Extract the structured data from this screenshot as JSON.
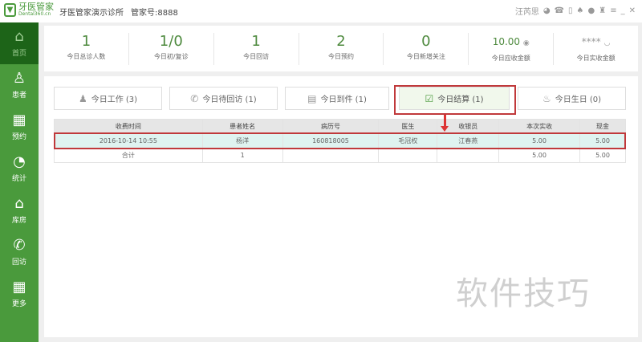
{
  "app": {
    "logo_text": "牙医管家",
    "logo_sub": "Dental360.cn",
    "clinic": "牙医管家演示诊所",
    "account": "管家号:8888",
    "user": "汪芮思"
  },
  "window_icons": [
    "wechat-icon",
    "phone-icon",
    "mobile-icon",
    "bell-icon",
    "help-icon",
    "shirt-icon",
    "menu-icon",
    "minimize-icon",
    "close-icon"
  ],
  "sidebar": {
    "items": [
      {
        "label": "首页",
        "icon": "home-icon"
      },
      {
        "label": "患者",
        "icon": "person-icon"
      },
      {
        "label": "预约",
        "icon": "calendar-icon"
      },
      {
        "label": "统计",
        "icon": "pie-chart-icon"
      },
      {
        "label": "库房",
        "icon": "warehouse-icon"
      },
      {
        "label": "回访",
        "icon": "phone-icon"
      },
      {
        "label": "更多",
        "icon": "grid-icon"
      }
    ]
  },
  "stats": [
    {
      "value": "1",
      "label": "今日总诊人数"
    },
    {
      "value": "1/0",
      "label": "今日初/复诊"
    },
    {
      "value": "1",
      "label": "今日回访"
    },
    {
      "value": "2",
      "label": "今日预约"
    },
    {
      "value": "0",
      "label": "今日新增关注"
    },
    {
      "value": "10.00",
      "label": "今日应收金额"
    },
    {
      "value": "****",
      "label": "今日实收金额"
    }
  ],
  "tabs": [
    {
      "label": "今日工作 (3)"
    },
    {
      "label": "今日待回访 (1)"
    },
    {
      "label": "今日到件 (1)"
    },
    {
      "label": "今日结算 (1)"
    },
    {
      "label": "今日生日 (0)"
    }
  ],
  "table": {
    "headers": [
      "收费时间",
      "患者姓名",
      "病历号",
      "医生",
      "收银员",
      "本次实收",
      "现金"
    ],
    "rows": [
      [
        "2016-10-14 10:55",
        "杨洋",
        "160818005",
        "毛冠权",
        "江春燕",
        "5.00",
        "5.00"
      ],
      [
        "合计",
        "1",
        "",
        "",
        "",
        "5.00",
        "5.00"
      ]
    ]
  },
  "colors": {
    "brand": "#4a9a3c",
    "highlight": "#c0393b"
  },
  "watermark": "软件技巧"
}
